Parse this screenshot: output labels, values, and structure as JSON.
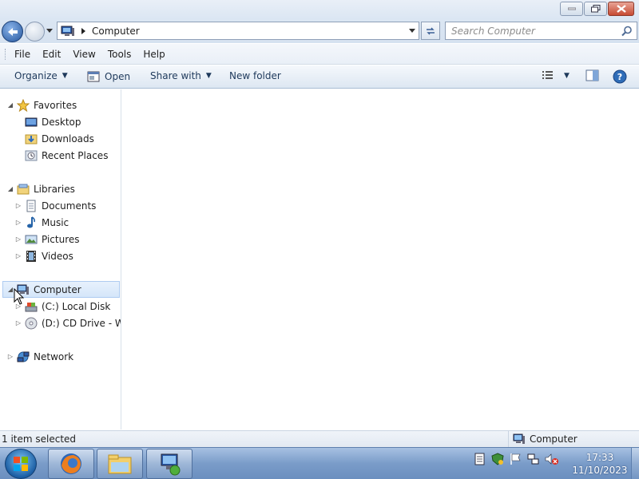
{
  "address": {
    "location": "Computer",
    "search_placeholder": "Search Computer"
  },
  "menu": {
    "file": "File",
    "edit": "Edit",
    "view": "View",
    "tools": "Tools",
    "help": "Help"
  },
  "commands": {
    "organize": "Organize",
    "open": "Open",
    "share_with": "Share with",
    "new_folder": "New folder"
  },
  "nav": {
    "favorites": "Favorites",
    "desktop": "Desktop",
    "downloads": "Downloads",
    "recent_places": "Recent Places",
    "libraries": "Libraries",
    "documents": "Documents",
    "music": "Music",
    "pictures": "Pictures",
    "videos": "Videos",
    "computer": "Computer",
    "local_disk": "(C:) Local Disk",
    "cd_drive": "(D:) CD Drive - Win",
    "network": "Network"
  },
  "status": {
    "selection": "1 item selected",
    "location": "Computer"
  },
  "taskbar": {
    "time": "17:33",
    "date": "11/10/2023"
  },
  "colors": {
    "accent": "#24559c",
    "selection_bg": "#d5e6fa",
    "taskbar": "#7a9cc9"
  }
}
